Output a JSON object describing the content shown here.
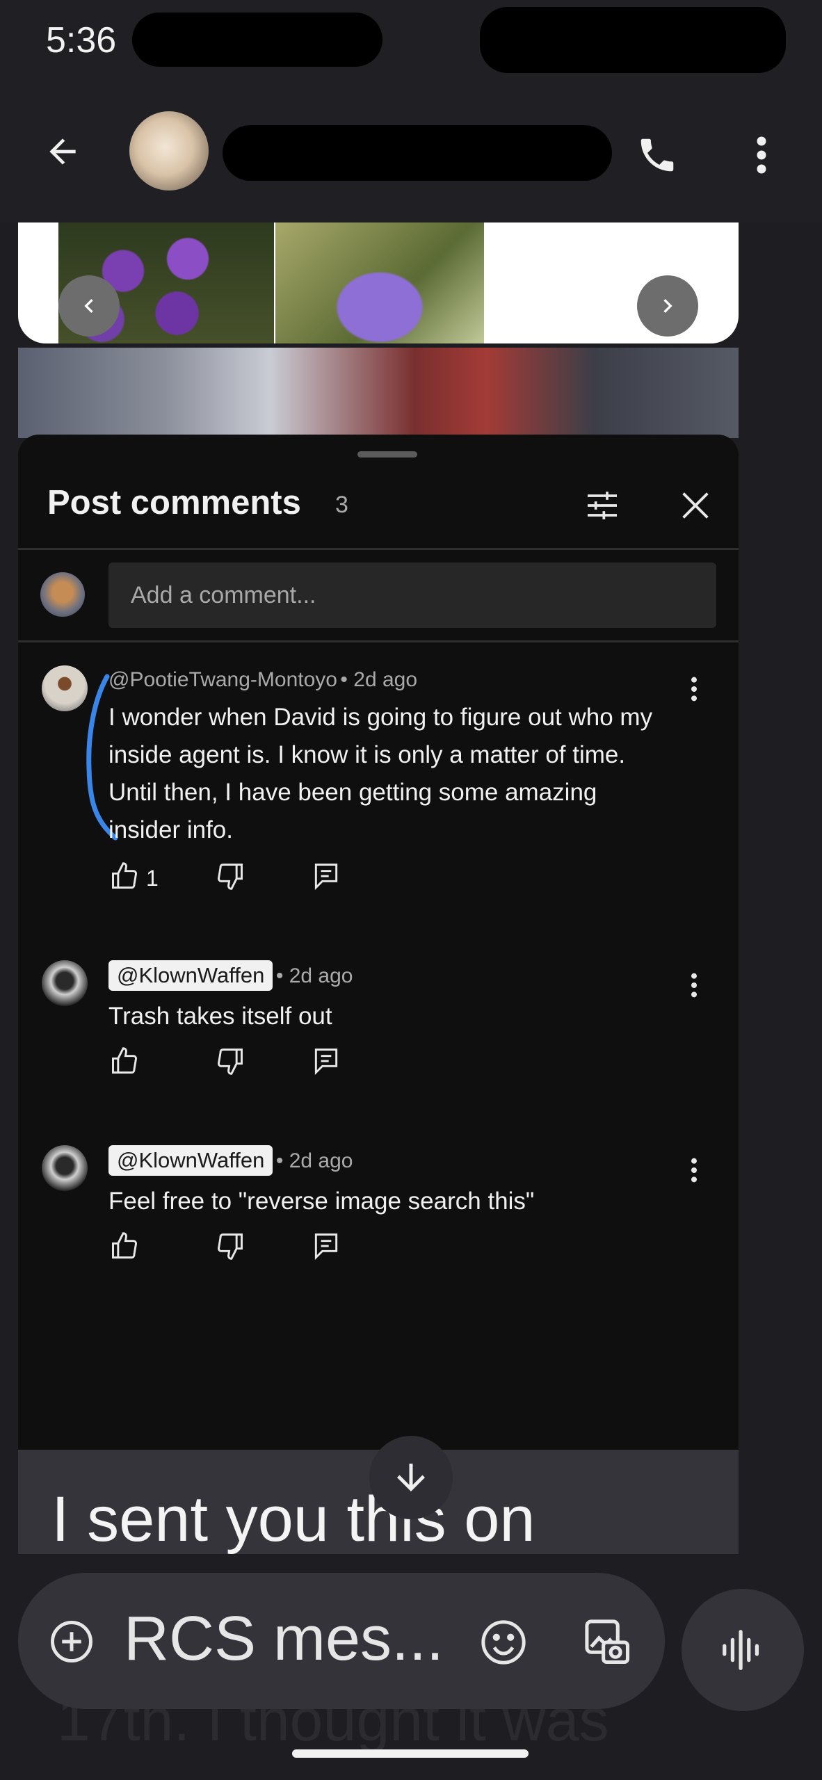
{
  "status_bar": {
    "time": "5:36"
  },
  "conversation_header": {
    "contact_name": "",
    "icons": {
      "back": "arrow-left-icon",
      "call": "phone-icon",
      "menu": "more-vert-icon"
    }
  },
  "comments_sheet": {
    "title": "Post comments",
    "count": "3",
    "input_placeholder": "Add a comment...",
    "comments": [
      {
        "author": "@PootieTwang-Montoyo",
        "time": "• 2d ago",
        "text": "I wonder when David is going to figure out who my inside agent is. I know it is only a matter of time. Until then, I have been getting some amazing insider info.",
        "likes": "1"
      },
      {
        "author": "@KlownWaffen",
        "time": "• 2d ago",
        "text": "Trash takes itself out",
        "likes": ""
      },
      {
        "author": "@KlownWaffen",
        "time": "• 2d ago",
        "text": "Feel free to \"reverse image search this\"",
        "likes": ""
      }
    ]
  },
  "messages": {
    "partial_text": "I sent you this on",
    "faded_text": "17th. I thought it was"
  },
  "compose": {
    "placeholder": "RCS mes...",
    "icons": {
      "attach": "add-circle-icon",
      "emoji": "emoji-icon",
      "gallery": "gallery-icon",
      "voice": "voice-waveform-icon"
    }
  }
}
